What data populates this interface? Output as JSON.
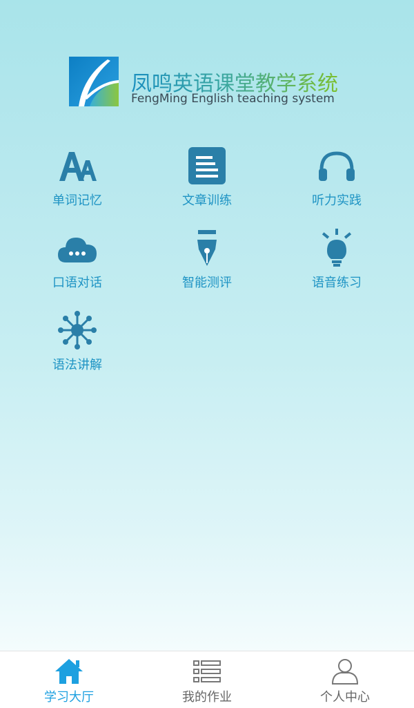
{
  "header": {
    "title_cn": "凤鸣英语课堂教学系统",
    "title_en": "FengMing English teaching system"
  },
  "menu": {
    "items": [
      {
        "label": "单词记忆",
        "icon": "font-size-icon"
      },
      {
        "label": "文章训练",
        "icon": "article-icon"
      },
      {
        "label": "听力实践",
        "icon": "headphones-icon"
      },
      {
        "label": "口语对话",
        "icon": "chat-cloud-icon"
      },
      {
        "label": "智能测评",
        "icon": "pen-nib-icon"
      },
      {
        "label": "语音练习",
        "icon": "lightbulb-icon"
      },
      {
        "label": "语法讲解",
        "icon": "molecule-icon"
      }
    ]
  },
  "tabbar": {
    "items": [
      {
        "label": "学习大厅",
        "icon": "home-icon",
        "active": true
      },
      {
        "label": "我的作业",
        "icon": "list-icon",
        "active": false
      },
      {
        "label": "个人中心",
        "icon": "user-icon",
        "active": false
      }
    ]
  },
  "colors": {
    "icon": "#2a7fa8",
    "label": "#1f94c4",
    "tab_active": "#1da0e0",
    "tab_inactive": "#666666"
  }
}
